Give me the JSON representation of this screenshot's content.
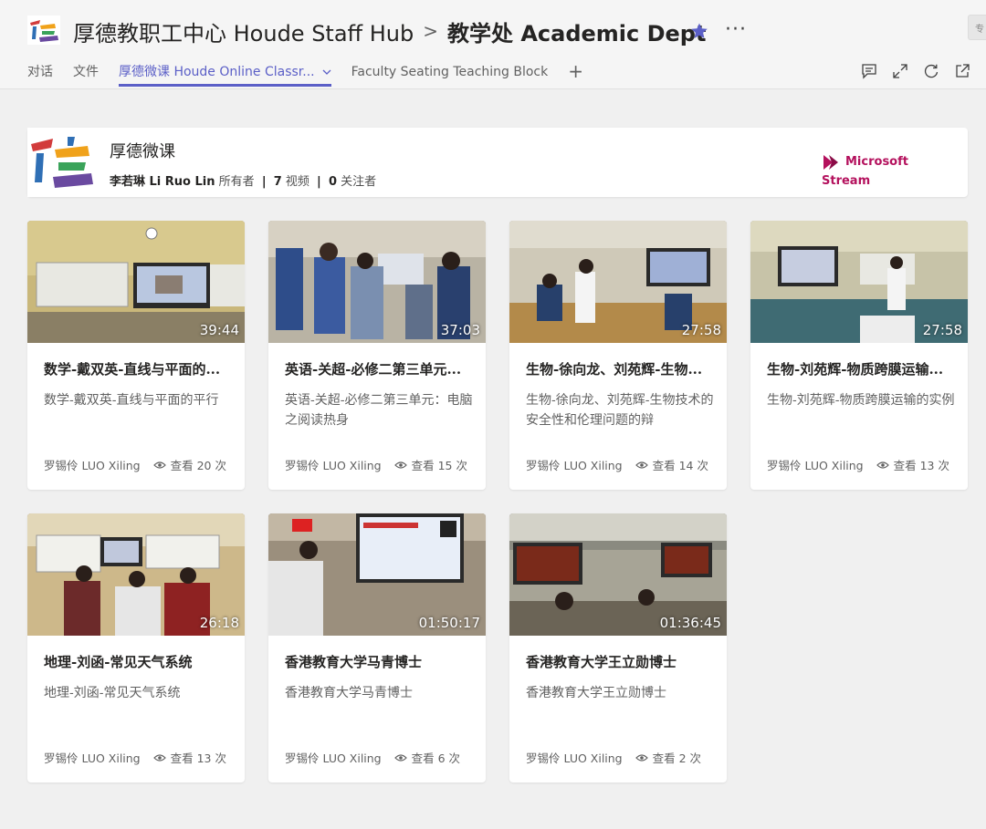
{
  "header": {
    "team_name": "厚德教职工中心 Houde Staff Hub",
    "separator": ">",
    "channel_name": "教学处 Academic Dept",
    "more_label": "···",
    "truncated_right": "专"
  },
  "tabs": [
    {
      "label": "对话",
      "active": false
    },
    {
      "label": "文件",
      "active": false
    },
    {
      "label": "厚德微课 Houde Online Classr...",
      "active": true
    },
    {
      "label": "Faculty Seating Teaching Block",
      "active": false
    }
  ],
  "tab_add_label": "+",
  "toolbar_icons": [
    "chat-icon",
    "expand-icon",
    "refresh-icon",
    "popout-icon"
  ],
  "colors": {
    "accent": "#5b5fc7",
    "stream_brand": "#b4115d"
  },
  "banner": {
    "title": "厚德微课",
    "owner": "李若琳 Li Ruo Lin",
    "owner_role": "所有者",
    "sep": "|",
    "video_count": "7",
    "video_label": "视频",
    "follower_count": "0",
    "follower_label": "关注者",
    "stream_line1": "Microsoft",
    "stream_line2": "Stream"
  },
  "videos": [
    {
      "duration": "39:44",
      "title": "数学-戴双英-直线与平面的...",
      "desc": "数学-戴双英-直线与平面的平行",
      "owner": "罗锡伶 LUO Xiling",
      "views": "查看 20 次"
    },
    {
      "duration": "37:03",
      "title": "英语-关超-必修二第三单元...",
      "desc": "英语-关超-必修二第三单元：电脑之阅读热身",
      "owner": "罗锡伶 LUO Xiling",
      "views": "查看 15 次"
    },
    {
      "duration": "27:58",
      "title": "生物-徐向龙、刘苑辉-生物...",
      "desc": "生物-徐向龙、刘苑辉-生物技术的安全性和伦理问题的辩",
      "owner": "罗锡伶 LUO Xiling",
      "views": "查看 14 次"
    },
    {
      "duration": "27:58",
      "title": "生物-刘苑辉-物质跨膜运输...",
      "desc": "生物-刘苑辉-物质跨膜运输的实例",
      "owner": "罗锡伶 LUO Xiling",
      "views": "查看 13 次"
    },
    {
      "duration": "26:18",
      "title": "地理-刘函-常见天气系统",
      "desc": "地理-刘函-常见天气系统",
      "owner": "罗锡伶 LUO Xiling",
      "views": "查看 13 次"
    },
    {
      "duration": "01:50:17",
      "title": "香港教育大学马青博士",
      "desc": "香港教育大学马青博士",
      "owner": "罗锡伶 LUO Xiling",
      "views": "查看 6 次"
    },
    {
      "duration": "01:36:45",
      "title": "香港教育大学王立勋博士",
      "desc": "香港教育大学王立勋博士",
      "owner": "罗锡伶 LUO Xiling",
      "views": "查看 2 次"
    }
  ]
}
